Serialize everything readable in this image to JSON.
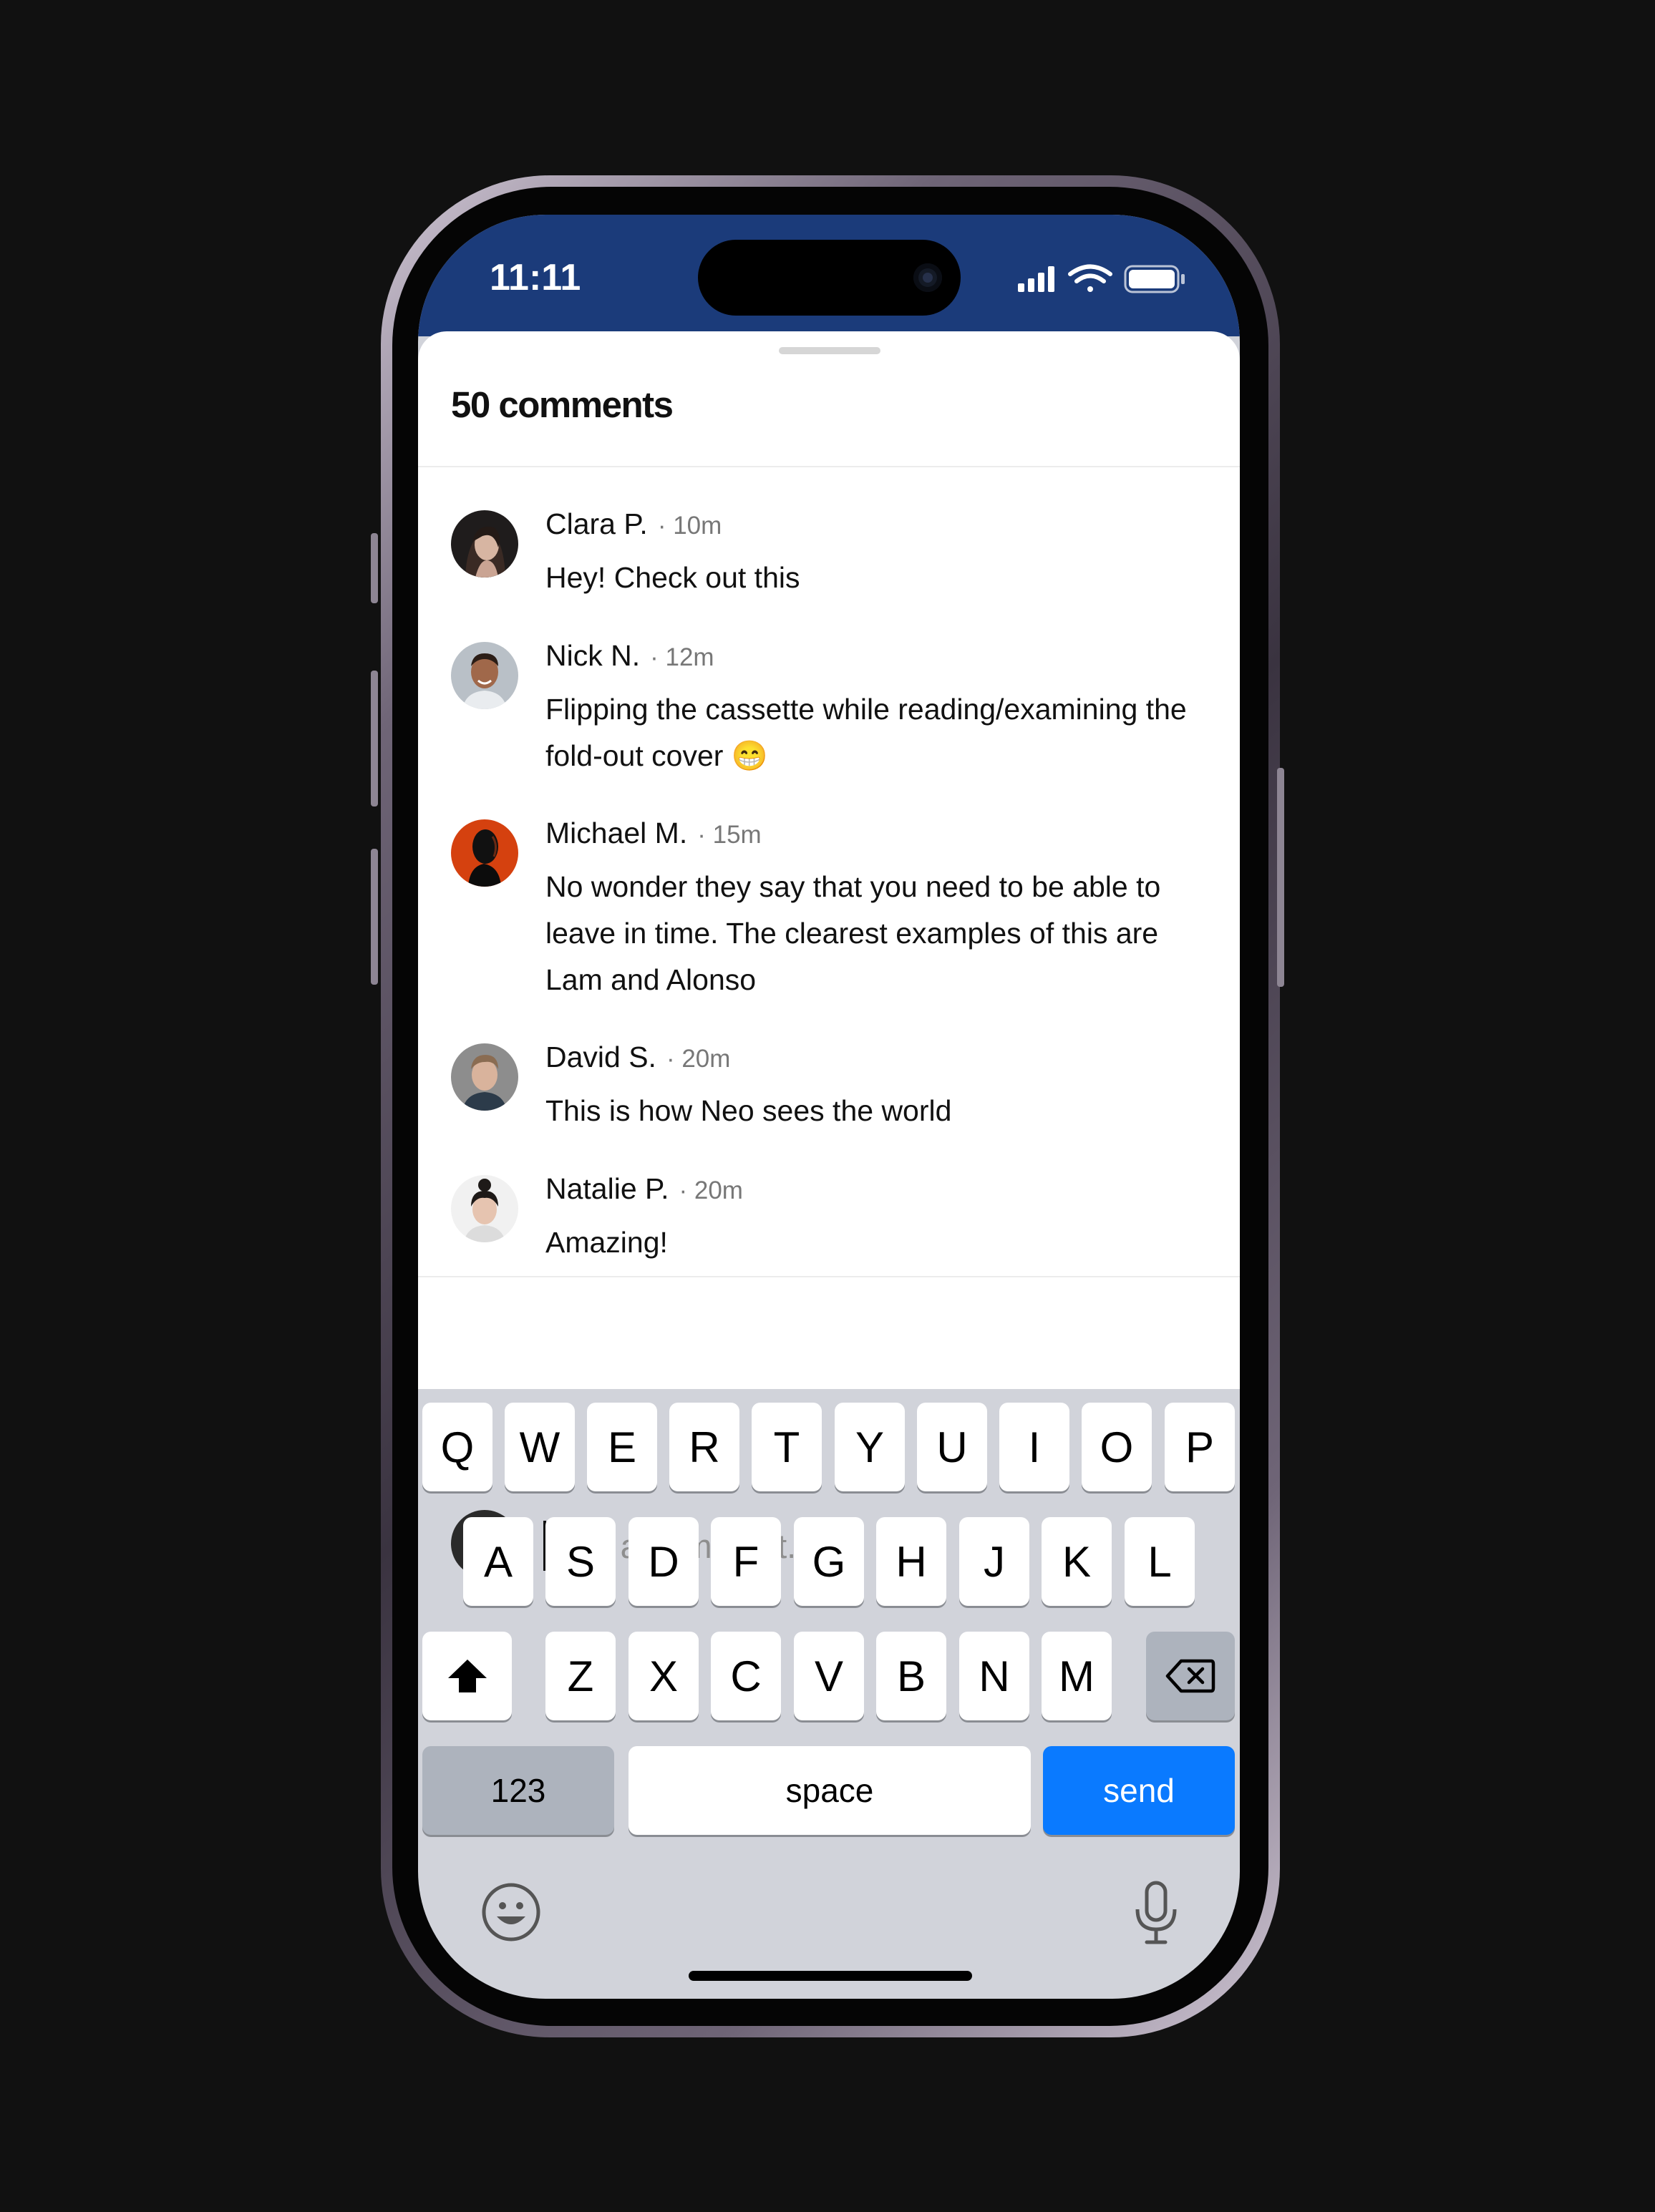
{
  "status_bar": {
    "time": "11:11"
  },
  "sheet": {
    "title": "50 comments"
  },
  "comments": [
    {
      "name": "Clara P.",
      "time": "· 10m",
      "text": "Hey! Check out this"
    },
    {
      "name": "Nick N.",
      "time": "· 12m",
      "text": "Flipping the cassette while reading/examining the fold-out cover 😁"
    },
    {
      "name": "Michael M.",
      "time": "· 15m",
      "text": "No wonder they say that you need to be able to leave in time. The clearest examples of this are Lam and Alonso"
    },
    {
      "name": "David S.",
      "time": "· 20m",
      "text": "This is how Neo sees the world"
    },
    {
      "name": "Natalie P.",
      "time": "· 20m",
      "text": "Amazing!"
    }
  ],
  "composer": {
    "placeholder": "Add a comment....",
    "value": ""
  },
  "keyboard": {
    "row1": [
      "Q",
      "W",
      "E",
      "R",
      "T",
      "Y",
      "U",
      "I",
      "O",
      "P"
    ],
    "row2": [
      "A",
      "S",
      "D",
      "F",
      "G",
      "H",
      "J",
      "K",
      "L"
    ],
    "row3": [
      "Z",
      "X",
      "C",
      "V",
      "B",
      "N",
      "M"
    ],
    "numbers_label": "123",
    "space_label": "space",
    "send_label": "send"
  },
  "colors": {
    "status_bar": "#1b3b7a",
    "send": "#0a7aff",
    "keyboard_bg": "#d1d3da"
  },
  "icons": [
    "signal-icon",
    "wifi-icon",
    "battery-icon",
    "shift-icon",
    "backspace-icon",
    "emoji-icon",
    "microphone-icon"
  ]
}
